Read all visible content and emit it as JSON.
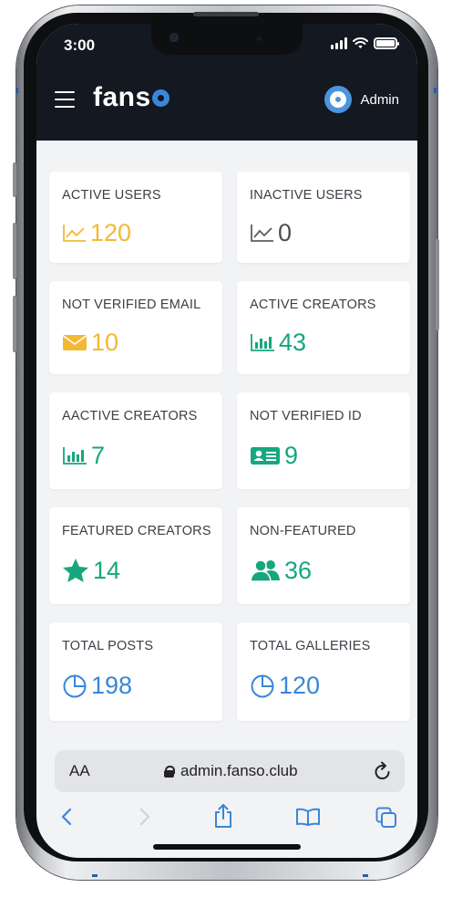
{
  "status_bar": {
    "time": "3:00"
  },
  "header": {
    "brand": "fans",
    "user_label": "Admin"
  },
  "cards": [
    {
      "title": "ACTIVE USERS",
      "value": "120",
      "icon": "line-chart-icon",
      "color": "#f3b933"
    },
    {
      "title": "INACTIVE USERS",
      "value": "0",
      "icon": "line-chart-icon",
      "color": "#4b4f57"
    },
    {
      "title": "NOT VERIFIED EMAIL",
      "value": "10",
      "icon": "envelope-icon",
      "color": "#f3b933"
    },
    {
      "title": "ACTIVE CREATORS",
      "value": "43",
      "icon": "bar-chart-icon",
      "color": "#16a77e"
    },
    {
      "title": "AACTIVE CREATORS",
      "value": "7",
      "icon": "bar-chart-icon",
      "color": "#16a77e"
    },
    {
      "title": "NOT VERIFIED ID",
      "value": "9",
      "icon": "id-card-icon",
      "color": "#16a77e"
    },
    {
      "title": "FEATURED CREATORS",
      "value": "14",
      "icon": "star-icon",
      "color": "#16a77e"
    },
    {
      "title": "NON-FEATURED",
      "value": "36",
      "icon": "users-icon",
      "color": "#16a77e"
    },
    {
      "title": "TOTAL POSTS",
      "value": "198",
      "icon": "pie-chart-icon",
      "color": "#3a86d8"
    },
    {
      "title": "TOTAL GALLERIES",
      "value": "120",
      "icon": "pie-chart-icon",
      "color": "#3a86d8"
    }
  ],
  "browser": {
    "aa_label": "AA",
    "url": "admin.fanso.club"
  },
  "colors": {
    "header_bg": "#131821",
    "accent_blue": "#3a86d8",
    "accent_yellow": "#f3b933",
    "accent_green": "#16a77e"
  }
}
